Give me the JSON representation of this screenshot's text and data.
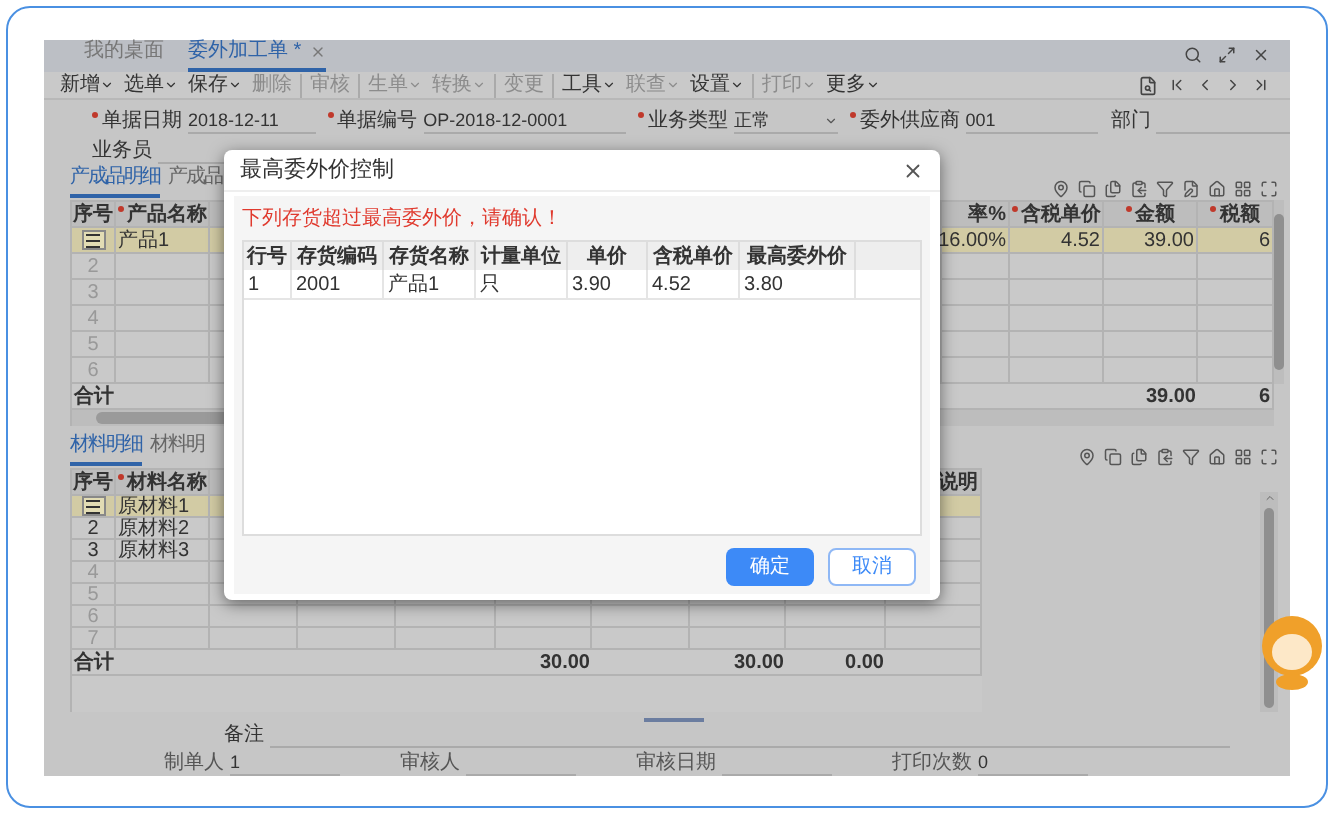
{
  "tabs": [
    {
      "label": "我的桌面",
      "selected": false,
      "closable": false
    },
    {
      "label": "委外加工单 *",
      "selected": true,
      "closable": true
    }
  ],
  "toolbar_groups": [
    [
      {
        "label": "新增",
        "menu": true,
        "disabled": false
      },
      {
        "label": "选单",
        "menu": true,
        "disabled": false
      },
      {
        "label": "保存",
        "menu": true,
        "disabled": false
      },
      {
        "label": "删除",
        "menu": false,
        "disabled": true
      }
    ],
    [
      {
        "label": "审核",
        "menu": false,
        "disabled": true
      }
    ],
    [
      {
        "label": "生单",
        "menu": true,
        "disabled": true
      },
      {
        "label": "转换",
        "menu": true,
        "disabled": true
      }
    ],
    [
      {
        "label": "变更",
        "menu": false,
        "disabled": true
      }
    ],
    [
      {
        "label": "工具",
        "menu": true,
        "disabled": false
      },
      {
        "label": "联查",
        "menu": true,
        "disabled": true
      },
      {
        "label": "设置",
        "menu": true,
        "disabled": false
      }
    ],
    [
      {
        "label": "打印",
        "menu": true,
        "disabled": true
      },
      {
        "label": "更多",
        "menu": true,
        "disabled": false
      }
    ]
  ],
  "form_rows": [
    [
      {
        "label": "单据日期",
        "required": true,
        "value": "2018-12-11",
        "kind": "text"
      },
      {
        "label": "单据编号",
        "required": true,
        "value": "OP-2018-12-0001",
        "kind": "text"
      },
      {
        "label": "业务类型",
        "required": true,
        "value": "正常",
        "kind": "select"
      },
      {
        "label": "委外供应商",
        "required": true,
        "value": "001",
        "kind": "text"
      },
      {
        "label": "部门",
        "required": false,
        "kind": "text"
      }
    ],
    [
      {
        "label": "业务员",
        "required": false,
        "kind": "text"
      }
    ]
  ],
  "product_tabs": [
    {
      "label": "产成品明细",
      "selected": true
    },
    {
      "label": "产成品",
      "selected": false
    }
  ],
  "products": {
    "columns_left": [
      {
        "label": "序号",
        "required": false
      },
      {
        "label": "产品名称",
        "required": true
      }
    ],
    "columns_right": [
      {
        "label": "率%",
        "required": false
      },
      {
        "label": "含税单价",
        "required": true
      },
      {
        "label": "金额",
        "required": true
      },
      {
        "label": "税额",
        "required": true
      }
    ],
    "rows": [
      {
        "selected": true,
        "name": "产品1",
        "values": [
          "16.00%",
          "4.52",
          "39.00",
          "6"
        ]
      },
      {
        "no": "2",
        "selected": false
      },
      {
        "no": "3",
        "selected": false
      },
      {
        "no": "4",
        "selected": false
      },
      {
        "no": "5",
        "selected": false
      },
      {
        "no": "6",
        "selected": false
      }
    ],
    "totals": {
      "label": "合计",
      "amount": "39.00",
      "tax": "6"
    }
  },
  "material_tabs": [
    {
      "label": "材料明细",
      "selected": true
    },
    {
      "label": "材料明",
      "selected": false
    }
  ],
  "materials": {
    "columns": [
      {
        "label": "序号",
        "required": false
      },
      {
        "label": "材料名称",
        "required": true
      },
      {
        "label": "说明",
        "required": false
      }
    ],
    "rows": [
      {
        "selected": true,
        "name": "原材料1"
      },
      {
        "no": "2",
        "selected": false,
        "name": "原材料2"
      },
      {
        "no": "3",
        "selected": false,
        "name": "原材料3"
      },
      {
        "no": "4",
        "selected": false
      },
      {
        "no": "5",
        "selected": false
      },
      {
        "no": "6",
        "selected": false
      },
      {
        "no": "7",
        "selected": false
      }
    ],
    "totals": {
      "label": "合计",
      "quantity": "30.00",
      "amount": "30.00",
      "tax": "0.00"
    }
  },
  "remarks": {
    "label": "备注"
  },
  "footer_fields": [
    {
      "label": "制单人",
      "value": "1"
    },
    {
      "label": "审核人"
    },
    {
      "label": "审核日期"
    },
    {
      "label": "打印次数",
      "value": "0"
    }
  ],
  "dialog": {
    "title": "最高委外价控制",
    "warning": "下列存货超过最高委外价，请确认！",
    "columns": [
      "行号",
      "存货编码",
      "存货名称",
      "计量单位",
      "单价",
      "含税单价",
      "最高委外价"
    ],
    "rows": [
      [
        "1",
        "2001",
        "产品1",
        "只",
        "3.90",
        "4.52",
        "3.80"
      ]
    ],
    "buttons": [
      {
        "label": "确定",
        "primary": true
      },
      {
        "label": "取消",
        "primary": false
      }
    ]
  }
}
